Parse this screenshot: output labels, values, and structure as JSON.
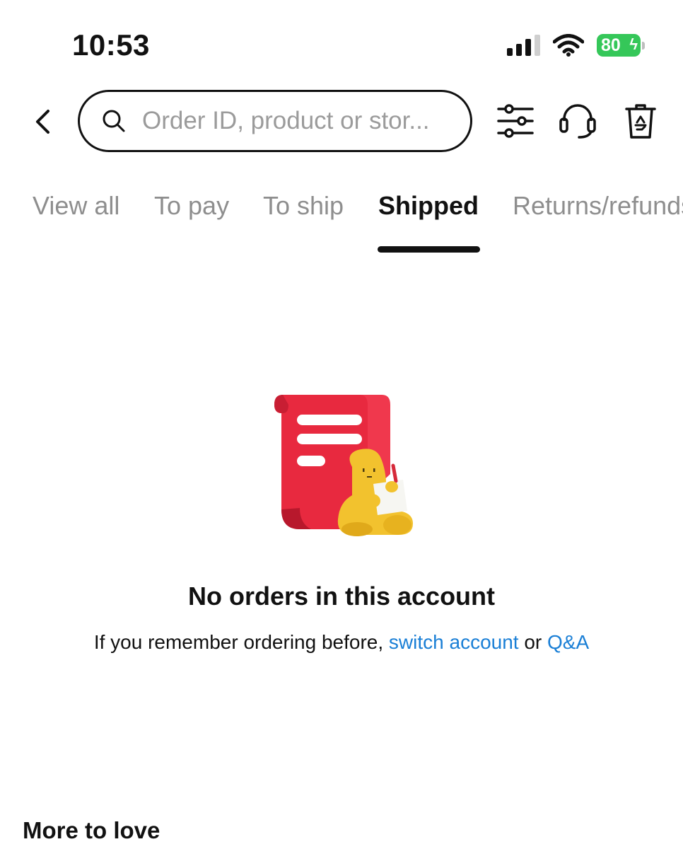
{
  "status_bar": {
    "time": "10:53",
    "battery_level": "80",
    "battery_color": "#35c759",
    "icons": [
      "cellular-signal-icon",
      "wifi-icon",
      "battery-charging-icon"
    ]
  },
  "header": {
    "back_icon": "chevron-left-icon",
    "search": {
      "placeholder": "Order ID, product or stor..."
    },
    "actions": [
      "filter-sliders-icon",
      "customer-service-headset-icon",
      "recycle-bin-icon"
    ]
  },
  "tabs": [
    {
      "label": "View all",
      "active": false
    },
    {
      "label": "To pay",
      "active": false
    },
    {
      "label": "To ship",
      "active": false
    },
    {
      "label": "Shipped",
      "active": true
    },
    {
      "label": "Returns/refunds",
      "active": false
    }
  ],
  "empty_state": {
    "illustration": "receipt-with-character-illustration",
    "title": "No orders in this account",
    "subtitle_prefix": "If you remember ordering before, ",
    "switch_account_link": "switch account",
    "conjunction": " or ",
    "qa_link": "Q&A",
    "link_color": "#1a7fd6"
  },
  "more_to_love": {
    "title": "More to love"
  }
}
